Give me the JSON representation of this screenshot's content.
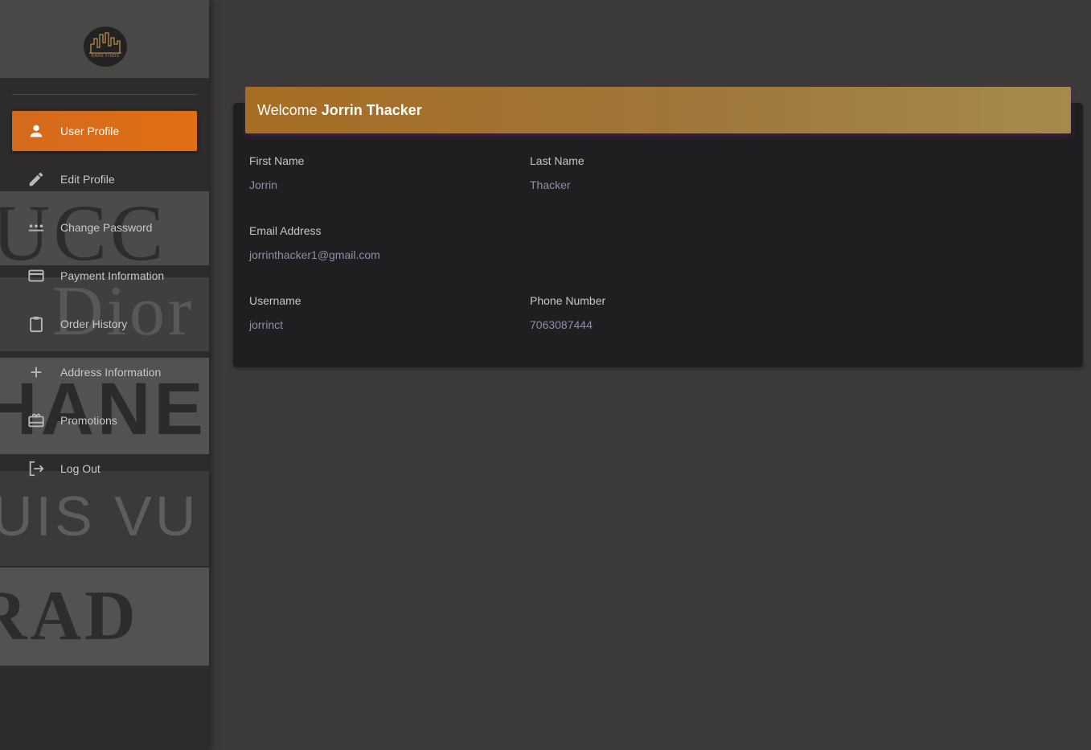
{
  "sidebar": {
    "logo_text": "RARE FINDS",
    "background_words": [
      "UCC",
      "Dior",
      "HANE",
      "UIS VU",
      "RAD"
    ],
    "items": [
      {
        "label": "User Profile",
        "icon": "person-icon",
        "active": true
      },
      {
        "label": "Edit Profile",
        "icon": "pencil-icon",
        "active": false
      },
      {
        "label": "Change Password",
        "icon": "password-icon",
        "active": false
      },
      {
        "label": "Payment Information",
        "icon": "credit-card-icon",
        "active": false
      },
      {
        "label": "Order History",
        "icon": "clipboard-icon",
        "active": false
      },
      {
        "label": "Address Information",
        "icon": "plus-icon",
        "active": false
      },
      {
        "label": "Promotions",
        "icon": "gift-card-icon",
        "active": false
      },
      {
        "label": "Log Out",
        "icon": "logout-icon",
        "active": false
      }
    ]
  },
  "profile": {
    "welcome_prefix": "Welcome",
    "welcome_name": "Jorrin Thacker",
    "first_name_label": "First Name",
    "first_name": "Jorrin",
    "last_name_label": "Last Name",
    "last_name": "Thacker",
    "email_label": "Email Address",
    "email": "jorrinthacker1@gmail.com",
    "username_label": "Username",
    "username": "jorrinct",
    "phone_label": "Phone Number",
    "phone": "7063087444"
  },
  "colors": {
    "accent": "#e06f14",
    "header_gold": "#a0773a",
    "card_bg": "#1f1e20",
    "page_bg": "#3c3a3b"
  }
}
